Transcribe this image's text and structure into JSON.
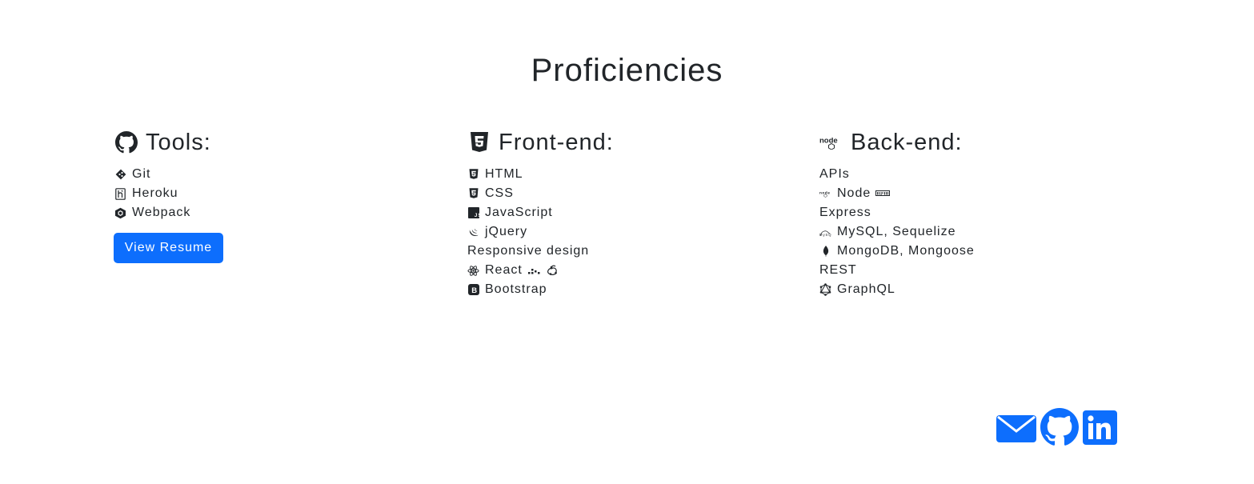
{
  "page": {
    "title": "Proficiencies"
  },
  "tools": {
    "heading": "Tools:",
    "heading_icon": "github-icon",
    "items": [
      {
        "label": "Git",
        "icon": "git-icon"
      },
      {
        "label": "Heroku",
        "icon": "heroku-icon"
      },
      {
        "label": "Webpack",
        "icon": "webpack-icon"
      }
    ],
    "resume_button": "View Resume"
  },
  "frontend": {
    "heading": "Front-end:",
    "heading_icon": "html5-icon",
    "items": [
      {
        "label": "HTML",
        "icon": "html5-icon"
      },
      {
        "label": "CSS",
        "icon": "css3-icon"
      },
      {
        "label": "JavaScript",
        "icon": "javascript-icon"
      },
      {
        "label": "jQuery",
        "icon": "jquery-icon"
      },
      {
        "label": "Responsive design",
        "icon": ""
      },
      {
        "label": "React",
        "icon": "react-icon",
        "extra_icons": [
          "redux-dots-icon",
          "redux-icon"
        ]
      },
      {
        "label": "Bootstrap",
        "icon": "bootstrap-icon"
      }
    ]
  },
  "backend": {
    "heading": "Back-end:",
    "heading_icon": "nodejs-logo-icon",
    "items": [
      {
        "label": "APIs",
        "icon": ""
      },
      {
        "label": "Node",
        "icon": "nodejs-logo-icon",
        "extra_icons": [
          "npm-icon"
        ]
      },
      {
        "label": "Express",
        "icon": ""
      },
      {
        "label": "MySQL, Sequelize",
        "icon": "mysql-icon"
      },
      {
        "label": "MongoDB, Mongoose",
        "icon": "mongodb-leaf-icon"
      },
      {
        "label": "REST",
        "icon": ""
      },
      {
        "label": "GraphQL",
        "icon": "graphql-icon"
      }
    ]
  },
  "social": {
    "links": [
      {
        "name": "email",
        "icon": "envelope-icon"
      },
      {
        "name": "github",
        "icon": "github-icon"
      },
      {
        "name": "linkedin",
        "icon": "linkedin-icon"
      }
    ]
  },
  "colors": {
    "accent": "#0d6efd",
    "text": "#212529",
    "background": "#ffffff"
  }
}
